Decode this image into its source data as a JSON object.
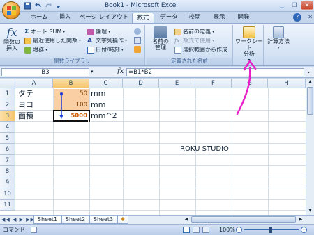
{
  "window": {
    "title": "Book1 - Microsoft Excel",
    "controls": [
      "minimize",
      "restore",
      "close"
    ]
  },
  "ribbon_tabs": [
    "ホーム",
    "挿入",
    "ページ レイアウト",
    "数式",
    "データ",
    "校閲",
    "表示",
    "開発"
  ],
  "active_tab": "数式",
  "ribbon": {
    "function_library": {
      "insert_function": "関数の\n挿入",
      "autosum": "オート SUM",
      "recent": "最近使用した関数",
      "financial": "財務",
      "logical": "論理",
      "text": "文字列操作",
      "datetime": "日付/時刻",
      "label": "関数ライブラリ"
    },
    "defined_names": {
      "name_manager": "名前の\n管理",
      "define_name": "名前の定義",
      "use_in_formula": "数式で使用",
      "create_from_selection": "選択範囲から作成",
      "label": "定義された名前"
    },
    "worksheet_analysis": "ワークシート\n分析",
    "calc_options": "計算方法"
  },
  "formula_bar": {
    "name_box": "B3",
    "fx": "fx",
    "formula": "=B1*B2"
  },
  "columns": [
    "A",
    "B",
    "C",
    "D",
    "E",
    "F",
    "G",
    "H"
  ],
  "rows": [
    "1",
    "2",
    "3",
    "4",
    "5",
    "6",
    "7",
    "8",
    "9",
    "10",
    "11"
  ],
  "cells": {
    "A1": "タテ",
    "A2": "ヨコ",
    "A3": "面積",
    "B1": "50",
    "B2": "100",
    "B3": "5000",
    "C1": "mm",
    "C2": "mm",
    "C3": "mm^2",
    "E6": "ROKU STUDIO"
  },
  "sheets": [
    "Sheet1",
    "Sheet2",
    "Sheet3"
  ],
  "active_sheet": "Sheet1",
  "status": {
    "mode": "コマンド",
    "zoom": "100%"
  },
  "colors": {
    "selection": "#f5c56c",
    "trace_arrow": "#1d3fd6",
    "annotation": "#e81fc9"
  }
}
